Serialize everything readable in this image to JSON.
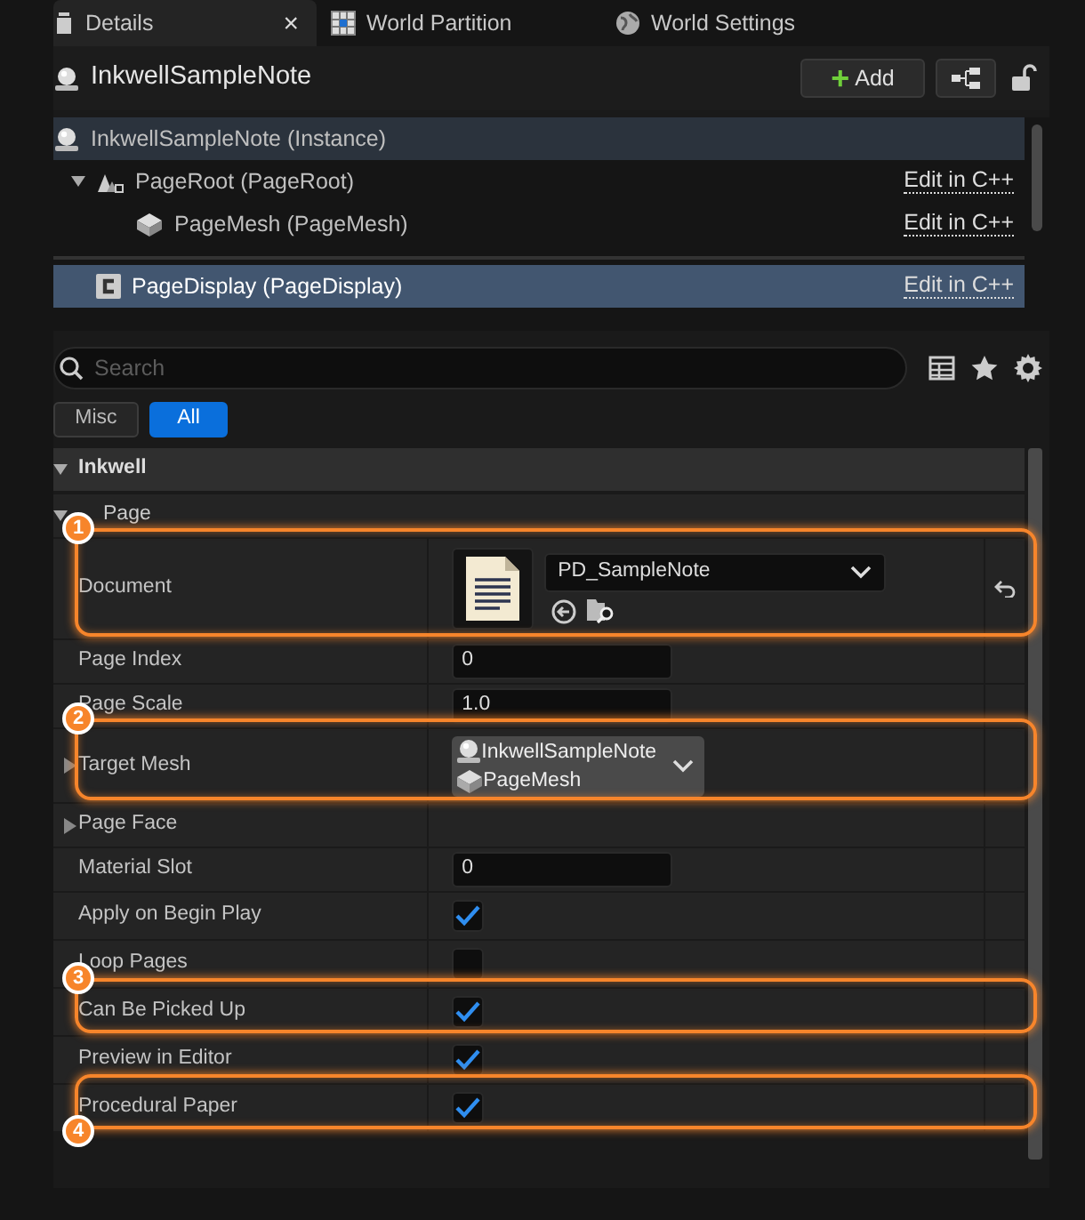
{
  "tabs": [
    {
      "label": "Details",
      "selected": true,
      "close": "×"
    },
    {
      "label": "World Partition",
      "selected": false
    },
    {
      "label": "World Settings",
      "selected": false
    }
  ],
  "header": {
    "title": "InkwellSampleNote",
    "add_button": {
      "icon": "+",
      "label": "Add"
    }
  },
  "components": {
    "instance": "InkwellSampleNote (Instance)",
    "items": [
      {
        "label": "PageRoot (PageRoot)",
        "kind": "scene",
        "expanded": true,
        "selected": false,
        "link": "Edit in C++",
        "children": [
          {
            "label": "PageMesh (PageMesh)",
            "kind": "mesh",
            "selected": false,
            "link": "Edit in C++"
          }
        ]
      },
      {
        "label": "PageDisplay (PageDisplay)",
        "kind": "class",
        "selected": true,
        "link": "Edit in C++",
        "separator_before": true
      }
    ]
  },
  "search": {
    "placeholder": "Search"
  },
  "filters": [
    {
      "label": "Misc",
      "selected": false
    },
    {
      "label": "All",
      "selected": true
    }
  ],
  "category": {
    "title": "Inkwell",
    "expanded": true,
    "subcategory": {
      "title": "Page",
      "expanded": true,
      "rows": [
        {
          "kind": "object",
          "label": "Document",
          "value": "PD_SampleNote",
          "resettable": true,
          "callout": "1"
        },
        {
          "kind": "number",
          "label": "Page Index",
          "value": "0"
        },
        {
          "kind": "number",
          "label": "Page Scale",
          "value": "1.0"
        },
        {
          "kind": "actor",
          "label": "Target Mesh",
          "expandable": true,
          "actor": "InkwellSampleNote",
          "component": "PageMesh",
          "callout": "2"
        },
        {
          "kind": "struct",
          "label": "Page Face",
          "expandable": true
        },
        {
          "kind": "number",
          "label": "Material Slot",
          "value": "0"
        },
        {
          "kind": "checkbox",
          "label": "Apply on Begin Play",
          "checked": true
        },
        {
          "kind": "checkbox",
          "label": "Loop Pages",
          "checked": false
        },
        {
          "kind": "checkbox",
          "label": "Can Be Picked Up",
          "checked": true,
          "callout": "3"
        },
        {
          "kind": "checkbox",
          "label": "Preview in Editor",
          "checked": true
        },
        {
          "kind": "checkbox",
          "label": "Procedural Paper",
          "checked": true,
          "callout": "4"
        }
      ]
    }
  }
}
